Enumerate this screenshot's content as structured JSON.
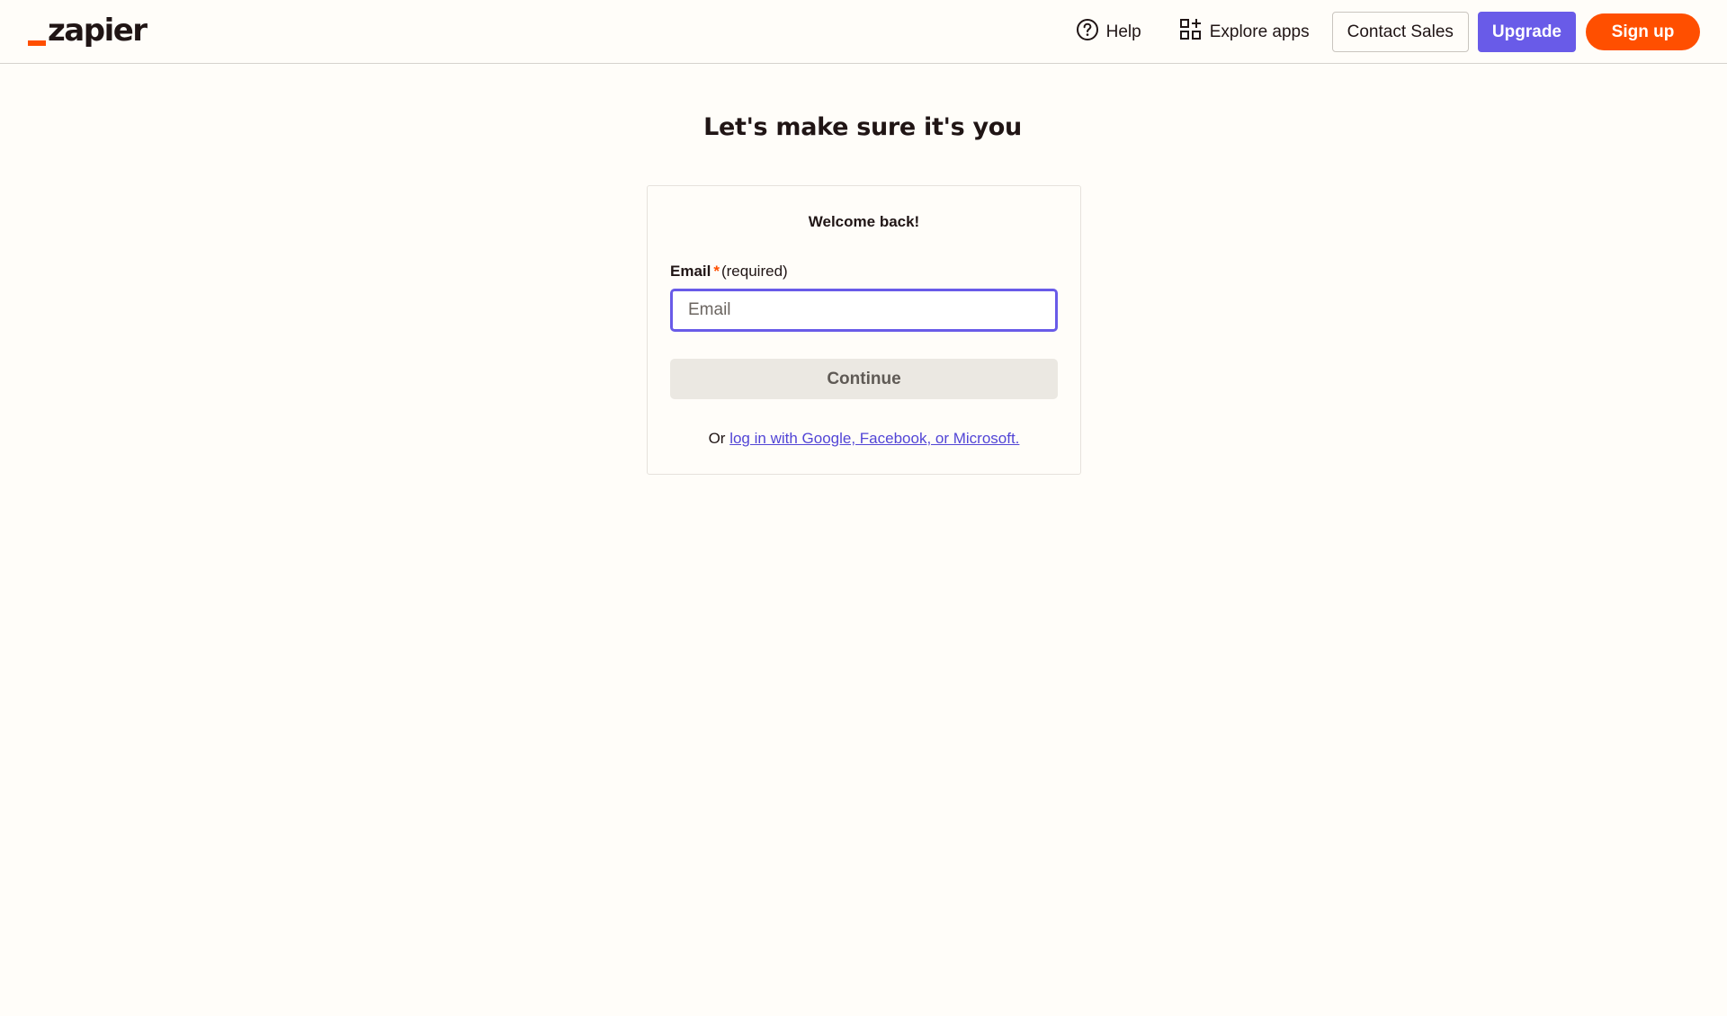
{
  "brand": {
    "name": "zapier",
    "accent_color": "#ff4f00"
  },
  "nav": {
    "help_label": "Help",
    "explore_label": "Explore apps",
    "contact_label": "Contact Sales",
    "upgrade_label": "Upgrade",
    "signup_label": "Sign up",
    "upgrade_color": "#695be8",
    "signup_color": "#ff4f00"
  },
  "page": {
    "heading": "Let's make sure it's you"
  },
  "login_card": {
    "title": "Welcome back!",
    "email_label": "Email",
    "required_star": "*",
    "required_text": "(required)",
    "email_placeholder": "Email",
    "email_value": "",
    "continue_label": "Continue",
    "alt_prefix": "Or",
    "alt_link_label": "log in with Google, Facebook, or Microsoft."
  }
}
